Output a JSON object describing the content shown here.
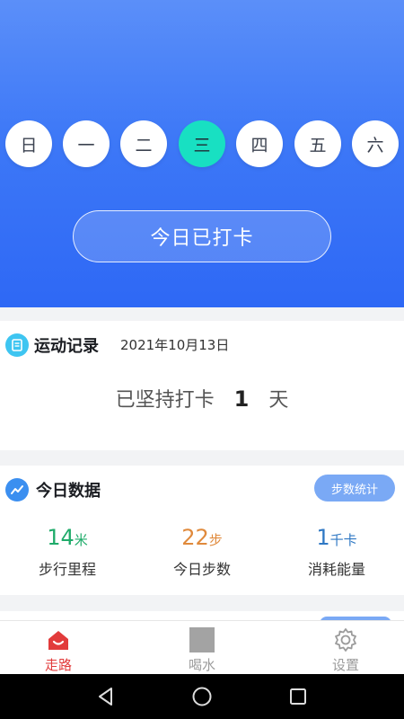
{
  "week": {
    "days": [
      "日",
      "一",
      "二",
      "三",
      "四",
      "五",
      "六"
    ],
    "selected_index": 3
  },
  "checkin": {
    "label": "今日已打卡"
  },
  "record": {
    "title": "运动记录",
    "date": "2021年10月13日",
    "streak_prefix": "已坚持打卡",
    "streak_value": "1",
    "streak_suffix": "天"
  },
  "today": {
    "title": "今日数据",
    "stats_button": "步数统计",
    "stats": [
      {
        "value": "14",
        "unit": "米",
        "label": "步行里程"
      },
      {
        "value": "22",
        "unit": "步",
        "label": "今日步数"
      },
      {
        "value": "1",
        "unit": "千卡",
        "label": "消耗能量"
      }
    ]
  },
  "tabbar": {
    "items": [
      {
        "label": "走路",
        "icon": "home-icon",
        "active": true
      },
      {
        "label": "喝水",
        "icon": "water-square-icon",
        "active": false
      },
      {
        "label": "设置",
        "icon": "gear-icon",
        "active": false
      }
    ]
  },
  "colors": {
    "hero_blue": "#3d78f7",
    "selected_day": "#18e0c2",
    "active_tab": "#e23b3b",
    "distance": "#1fab6a",
    "steps": "#e08a3c",
    "energy": "#2f78c4"
  },
  "system_nav": {
    "icons": [
      "back-icon",
      "home-circle-icon",
      "recents-icon"
    ]
  }
}
